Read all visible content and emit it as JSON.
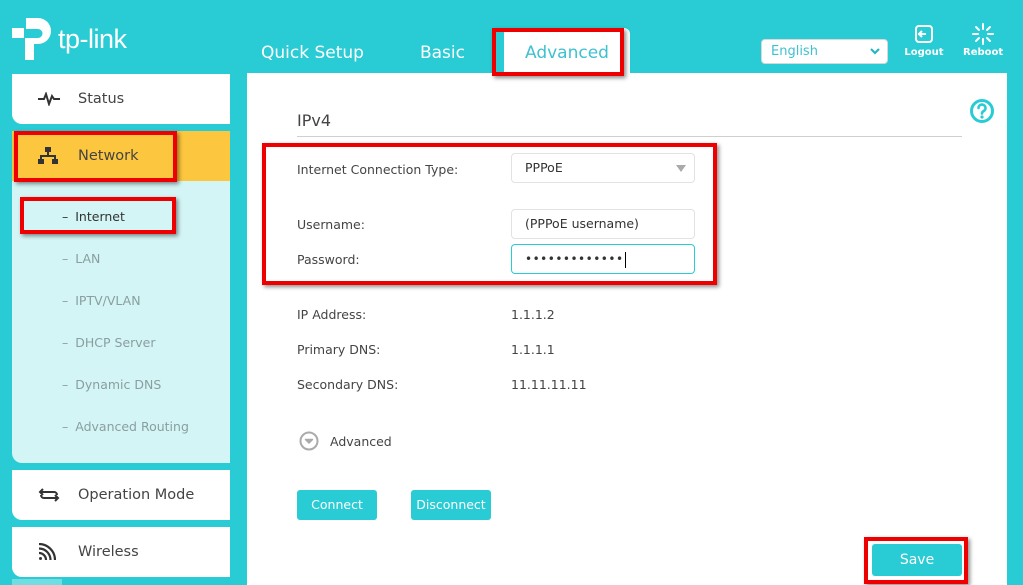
{
  "brand": {
    "name": "tp-link",
    "accent": "#29ccd4",
    "highlight": "#fcc63e"
  },
  "nav": {
    "tabs": [
      {
        "label": "Quick Setup",
        "active": false
      },
      {
        "label": "Basic",
        "active": false
      },
      {
        "label": "Advanced",
        "active": true
      }
    ]
  },
  "header": {
    "language": "English",
    "logout_label": "Logout",
    "reboot_label": "Reboot"
  },
  "sidebar": {
    "items": [
      {
        "label": "Status",
        "icon": "pulse-icon",
        "active": false
      },
      {
        "label": "Network",
        "icon": "network-icon",
        "active": true
      },
      {
        "label": "Operation Mode",
        "icon": "operation-mode-icon",
        "active": false
      },
      {
        "label": "Wireless",
        "icon": "wireless-icon",
        "active": false
      }
    ],
    "submenu": [
      {
        "label": "Internet",
        "active": true
      },
      {
        "label": "LAN",
        "active": false
      },
      {
        "label": "IPTV/VLAN",
        "active": false
      },
      {
        "label": "DHCP Server",
        "active": false
      },
      {
        "label": "Dynamic DNS",
        "active": false
      },
      {
        "label": "Advanced Routing",
        "active": false
      }
    ]
  },
  "main": {
    "section_title": "IPv4",
    "form": {
      "connection_type_label": "Internet Connection Type:",
      "connection_type_value": "PPPoE",
      "username_label": "Username:",
      "username_value": "(PPPoE username)",
      "password_label": "Password:",
      "password_value": "•••••••••••••"
    },
    "info": [
      {
        "label": "IP Address:",
        "value": "1.1.1.2"
      },
      {
        "label": "Primary DNS:",
        "value": "1.1.1.1"
      },
      {
        "label": "Secondary DNS:",
        "value": "11.11.11.11"
      }
    ],
    "advanced_label": "Advanced",
    "connect_label": "Connect",
    "disconnect_label": "Disconnect",
    "save_label": "Save"
  }
}
